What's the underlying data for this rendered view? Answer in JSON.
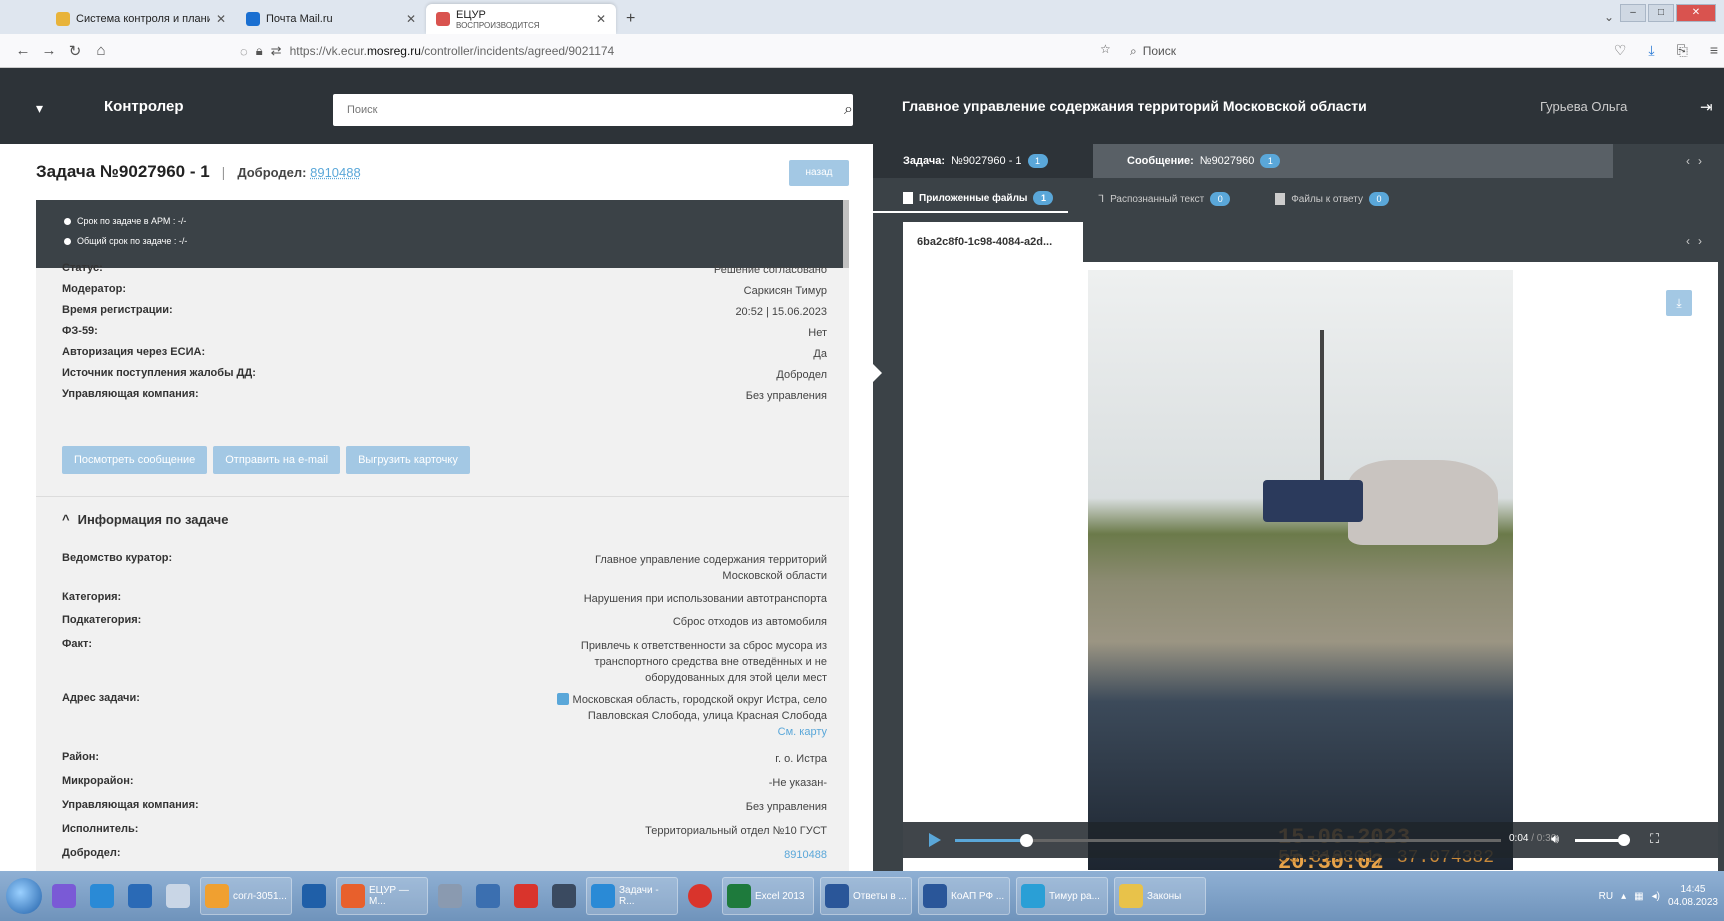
{
  "browser": {
    "tabs": [
      {
        "title": "Система контроля и планиро",
        "close": "✕",
        "icon_color": "#e8b33a"
      },
      {
        "title": "Почта Mail.ru",
        "close": "✕",
        "icon_color": "#1a6fd1"
      },
      {
        "title": "ЕЦУР",
        "subtitle": "ВОСПРОИЗВОДИТСЯ",
        "close": "✕",
        "icon_color": "#d9534f"
      }
    ],
    "new_tab": "+",
    "url_prefix": "https://vk.ecur.",
    "url_domain": "mosreg.ru",
    "url_path": "/controller/incidents/agreed/9021174",
    "search_placeholder": "Поиск"
  },
  "app": {
    "brand": "Контролер",
    "search_placeholder": "Поиск",
    "org": "Главное управление содержания территорий Московской области",
    "user": "Гурьева Ольга"
  },
  "task": {
    "title": "Задача №9027960 - 1",
    "separator": "|",
    "dobrodel_label": "Добродел:",
    "dobrodel_value": "8910488",
    "back_label": "назад",
    "deadlines": [
      "Срок по задаче в АРМ : -/-",
      "Общий срок по задаче : -/-"
    ],
    "fields": [
      {
        "label": "Статус:",
        "value": "Решение согласовано"
      },
      {
        "label": "Модератор:",
        "value": "Саркисян Тимур"
      },
      {
        "label": "Время регистрации:",
        "value": "20:52 | 15.06.2023"
      },
      {
        "label": "ФЗ-59:",
        "value": "Нет"
      },
      {
        "label": "Авторизация через ЕСИА:",
        "value": "Да"
      },
      {
        "label": "Источник поступления жалобы ДД:",
        "value": "Добродел"
      },
      {
        "label": "Управляющая компания:",
        "value": "Без управления"
      }
    ],
    "buttons": [
      "Посмотреть сообщение",
      "Отправить на e-mail",
      "Выгрузить карточку"
    ],
    "info_title": "Информация по задаче",
    "info_fields": [
      {
        "label": "Ведомство куратор:",
        "value": "Главное управление содержания территорий Московской области"
      },
      {
        "label": "Категория:",
        "value": "Нарушения при использовании автотранспорта"
      },
      {
        "label": "Подкатегория:",
        "value": "Сброс отходов из автомобиля"
      },
      {
        "label": "Факт:",
        "value": "Привлечь к ответственности за сброс мусора из транспортного средства вне отведённых и не оборудованных для этой цели мест"
      },
      {
        "label": "Адрес задачи:",
        "value": "Московская область, городской округ Истра, село Павловская Слобода, улица Красная Слобода",
        "link": "См. карту"
      },
      {
        "label": "Район:",
        "value": "г. о. Истра"
      },
      {
        "label": "Микрорайон:",
        "value": "-Не указан-"
      },
      {
        "label": "Управляющая компания:",
        "value": "Без управления"
      },
      {
        "label": "Исполнитель:",
        "value": "Территориальный отдел №10 ГУСТ"
      },
      {
        "label": "Добродел:",
        "value": "8910488"
      }
    ]
  },
  "viewer": {
    "task_tab_label": "Задача:",
    "task_tab_value": "№9027960 - 1",
    "task_tab_badge": "1",
    "msg_tab_label": "Сообщение:",
    "msg_tab_value": "№9027960",
    "msg_tab_badge": "1",
    "file_tabs": [
      {
        "label": "Приложенные файлы",
        "badge": "1"
      },
      {
        "label": "Распознанный текст",
        "badge": "0"
      },
      {
        "label": "Файлы к ответу",
        "badge": "0"
      }
    ],
    "file_name": "6ba2c8f0-1c98-4084-a2d...",
    "video_stamp": "15-06-2023 20:30:02",
    "video_coords": "55.819801, 37.074382",
    "time_current": "0:04",
    "time_total": "/ 0:30",
    "progress": 0.13
  },
  "taskbar": {
    "items": [
      {
        "label": "согл-3051...",
        "color": "#f0a030"
      },
      {
        "label": "ЕЦУР — M...",
        "color": "#e8602c"
      },
      {
        "label": "Задачи - R...",
        "color": "#2a8ad6"
      },
      {
        "label": "Excel 2013",
        "color": "#1e7a3c"
      },
      {
        "label": "Ответы в ...",
        "color": "#2a5699"
      },
      {
        "label": "КоАП РФ ...",
        "color": "#2a5699"
      },
      {
        "label": "Тимур ра...",
        "color": "#2a9fd6"
      },
      {
        "label": "Законы",
        "color": "#e8c24a"
      }
    ],
    "lang": "RU",
    "time": "14:45",
    "date": "04.08.2023"
  }
}
